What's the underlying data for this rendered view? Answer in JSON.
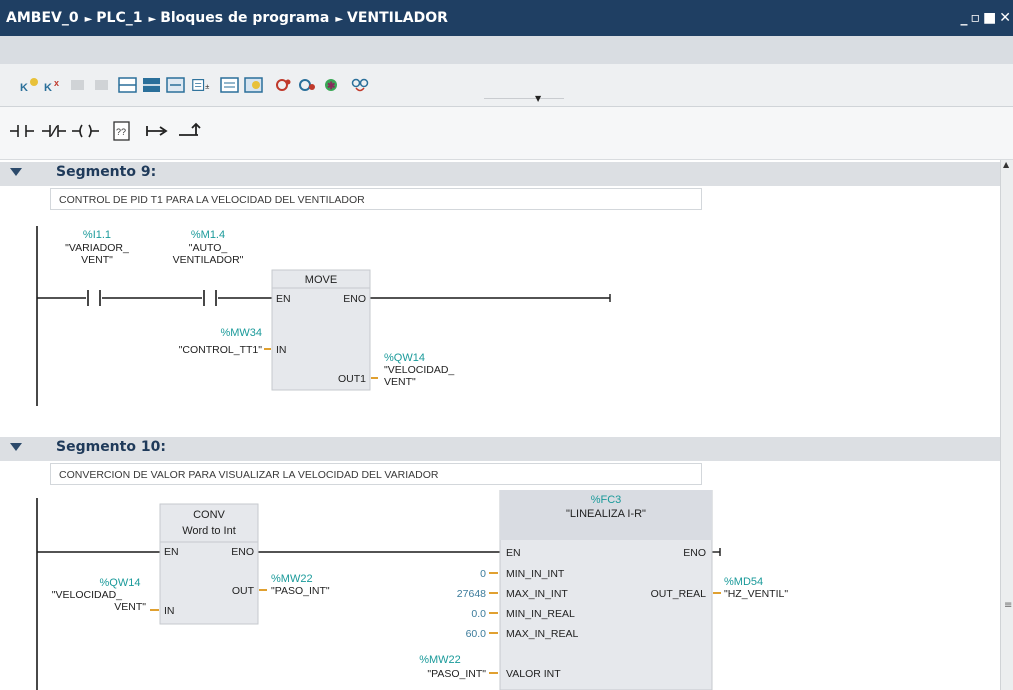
{
  "titlebar": {
    "crumbs": [
      "AMBEV_0",
      "PLC_1",
      "Bloques de programa",
      "VENTILADOR"
    ],
    "controls": [
      "_",
      "▫",
      "■",
      "✕"
    ]
  },
  "toolbar_icons": [
    "network-insert-icon",
    "network-delete-icon",
    "disabled-icon",
    "disabled-icon",
    "expand-all-icon",
    "collapse-all-icon",
    "toggle-comments-icon",
    "abs-operands-icon",
    "favorites-icon",
    "grid-icon",
    "monitor-icon",
    "breakpoint-icon",
    "call-icon",
    "reset-icon",
    "glasses-icon"
  ],
  "ladder_palette": [
    "normally-open-contact",
    "normally-closed-contact",
    "coil",
    "empty-box",
    "open-branch",
    "close-branch"
  ],
  "segments": [
    {
      "title": "Segmento 9:",
      "comment": "CONTROL DE PID T1 PARA LA VELOCIDAD DEL VENTILADOR",
      "contact1": {
        "addr": "%I1.1",
        "name1": "\"VARIADOR_",
        "name2": "VENT\""
      },
      "contact2": {
        "addr": "%M1.4",
        "name1": "\"AUTO_",
        "name2": "VENTILADOR\""
      },
      "block": {
        "title": "MOVE",
        "en": "EN",
        "eno": "ENO",
        "in": "IN",
        "out": "OUT1"
      },
      "in_tag": {
        "addr": "%MW34",
        "name": "\"CONTROL_TT1\""
      },
      "out_tag": {
        "addr": "%QW14",
        "name1": "\"VELOCIDAD_",
        "name2": "VENT\""
      }
    },
    {
      "title": "Segmento 10:",
      "comment": "CONVERCION DE VALOR PARA VISUALIZAR LA VELOCIDAD DEL VARIADOR",
      "conv": {
        "title1": "CONV",
        "title2": "Word to Int",
        "en": "EN",
        "eno": "ENO",
        "in": "IN",
        "out": "OUT"
      },
      "conv_in": {
        "addr": "%QW14",
        "name1": "\"VELOCIDAD_",
        "name2": "VENT\""
      },
      "conv_out": {
        "addr": "%MW22",
        "name": "\"PASO_INT\""
      },
      "fc": {
        "addr": "%FC3",
        "name": "\"LINEALIZA I-R\"",
        "en": "EN",
        "eno": "ENO",
        "pins": [
          "MIN_IN_INT",
          "MAX_IN_INT",
          "MIN_IN_REAL",
          "MAX_IN_REAL",
          "VALOR INT"
        ],
        "out": "OUT_REAL"
      },
      "fc_in_values": [
        "0",
        "27648",
        "0.0",
        "60.0"
      ],
      "fc_valor": {
        "addr": "%MW22",
        "name": "\"PASO_INT\""
      },
      "fc_out": {
        "addr": "%MD54",
        "name": "\"HZ_VENTIL\""
      }
    }
  ],
  "colors": {
    "titlebar": "#1f3f63",
    "address": "#1a9a9a",
    "block": "#e6e8ec",
    "line": "#1a1a1a"
  }
}
